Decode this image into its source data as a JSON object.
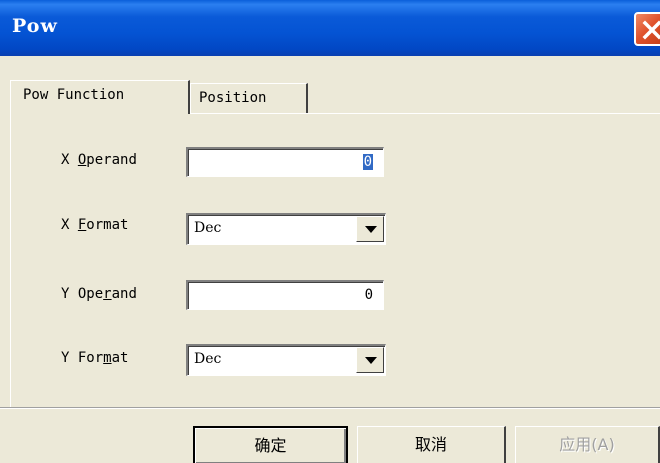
{
  "window": {
    "title": "Pow",
    "close_icon": "close-icon"
  },
  "tabs": [
    {
      "label": "Pow Function",
      "active": true
    },
    {
      "label": "Position",
      "active": false
    }
  ],
  "form": {
    "x_operand": {
      "label_pre": "X ",
      "label_mnemonic": "O",
      "label_post": "perand",
      "value": "0"
    },
    "x_format": {
      "label_pre": "X ",
      "label_mnemonic": "F",
      "label_post": "ormat",
      "value": "Dec"
    },
    "y_operand": {
      "label_pre": "Y Ope",
      "label_mnemonic": "r",
      "label_post": "and",
      "value": "0"
    },
    "y_format": {
      "label_pre": "Y For",
      "label_mnemonic": "m",
      "label_post": "at",
      "value": "Dec"
    }
  },
  "buttons": {
    "ok": "确定",
    "cancel": "取消",
    "apply": "应用(A)"
  },
  "colors": {
    "titlebar": "#0453d3",
    "close": "#e0532d",
    "face": "#ece9d8",
    "selection": "#316ac5"
  }
}
